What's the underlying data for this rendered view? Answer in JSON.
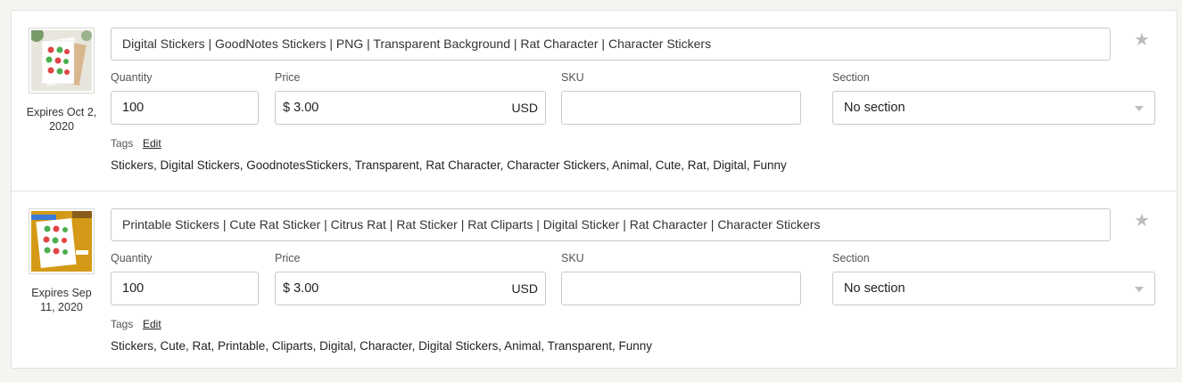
{
  "listings": [
    {
      "title": "Digital Stickers | GoodNotes Stickers | PNG | Transparent Background | Rat Character | Character Stickers",
      "expires": "Expires Oct 2, 2020",
      "quantity_label": "Quantity",
      "quantity": "100",
      "price_label": "Price",
      "price_symbol": "$",
      "price": "3.00",
      "currency": "USD",
      "sku_label": "SKU",
      "sku": "",
      "section_label": "Section",
      "section": "No section",
      "tags_label": "Tags",
      "tags_edit": "Edit",
      "tags": "Stickers, Digital Stickers, GoodnotesStickers, Transparent, Rat Character, Character Stickers, Animal, Cute, Rat, Digital, Funny",
      "thumbnail_bg": "#e8e6dc"
    },
    {
      "title": "Printable Stickers | Cute Rat Sticker | Citrus Rat | Rat Sticker | Rat Cliparts | Digital Sticker | Rat Character | Character Stickers",
      "expires": "Expires Sep 11, 2020",
      "quantity_label": "Quantity",
      "quantity": "100",
      "price_label": "Price",
      "price_symbol": "$",
      "price": "3.00",
      "currency": "USD",
      "sku_label": "SKU",
      "sku": "",
      "section_label": "Section",
      "section": "No section",
      "tags_label": "Tags",
      "tags_edit": "Edit",
      "tags": "Stickers, Cute, Rat, Printable, Cliparts, Digital, Character, Digital Stickers, Animal, Transparent, Funny",
      "thumbnail_bg": "#d49a17"
    }
  ],
  "icons": {
    "favorite": "star-icon",
    "dropdown": "chevron-down-icon"
  },
  "colors": {
    "border": "#c9c9c9",
    "star": "#bdbdbd"
  }
}
